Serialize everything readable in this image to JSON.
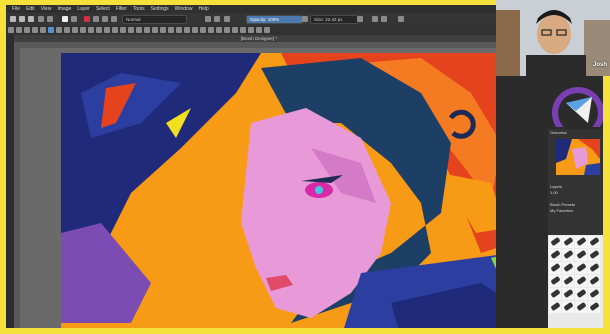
{
  "app": {
    "menu": [
      "File",
      "Edit",
      "View",
      "Image",
      "Layer",
      "Select",
      "Filter",
      "Tools",
      "Settings",
      "Window",
      "Help"
    ],
    "document_title": "[Brush Designer] *"
  },
  "toolbar": {
    "blend_mode": "Normal",
    "opacity": "Opacity: 100%",
    "size": "Size: 22.42 px"
  },
  "dockers": {
    "overview_label": "Overview",
    "layers_label": "Layers",
    "brush_presets_label": "Brush Presets",
    "tag_label": "My Favorites",
    "opacity_value": "1.00"
  },
  "webcam": {
    "name": "Josh"
  },
  "colors": {
    "frame": "#f4e23a",
    "canvas_bg": "#6a6a6a",
    "art_orange": "#f79a16",
    "art_navy": "#1f2a7a",
    "art_skin": "#e89ad8",
    "art_red": "#e4431e",
    "accent_blue": "#4a7ab0"
  }
}
